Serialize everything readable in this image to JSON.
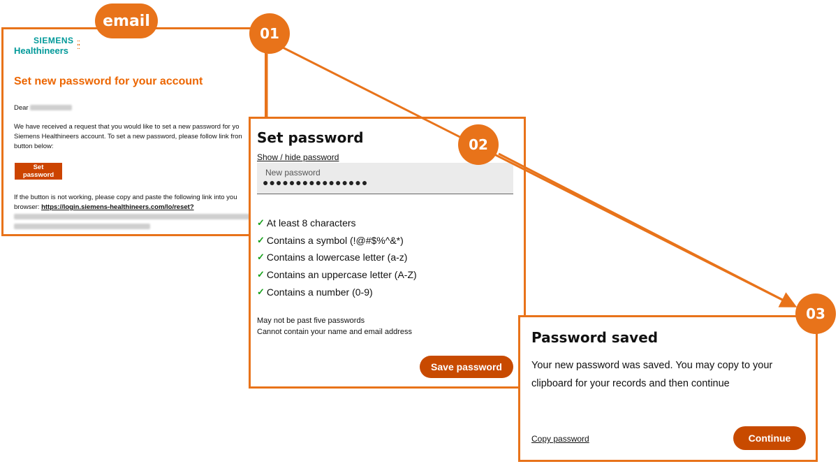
{
  "labels": {
    "email_tag": "email",
    "step1": "01",
    "step2": "02",
    "step3": "03"
  },
  "email": {
    "logo_top": "SIEMENS",
    "logo_bottom": "Healthineers",
    "title": "Set new password for your account",
    "greeting": "Dear",
    "body_line1": "We have received a request that you would like to set a new password for yo",
    "body_line2": "Siemens Healthineers account. To set a new password, please follow link fron",
    "body_line3": "button below:",
    "button": "Set password",
    "link_intro1": "If the button is not working, please copy and paste the following link into you",
    "link_intro2": "browser:",
    "link_url": "https://login.siemens-healthineers.com/lo/reset?"
  },
  "set_password": {
    "title": "Set password",
    "toggle": "Show / hide password",
    "field_label": "New password",
    "field_value": "●●●●●●●●●●●●●●●●",
    "rules": [
      "At least 8 characters",
      "Contains a symbol (!@#$%^&*)",
      "Contains a lowercase letter (a-z)",
      "Contains an uppercase letter (A-Z)",
      "Contains a number (0-9)"
    ],
    "check_mark": "✓",
    "note1": "May not be past five passwords",
    "note2": "Cannot contain your name and email address",
    "button": "Save password"
  },
  "saved": {
    "title": "Password saved",
    "message1": "Your new password was saved. You may copy to your",
    "message2": "clipboard for your records and then continue",
    "copy": "Copy password",
    "button": "Continue"
  },
  "colors": {
    "accent": "#e8731a",
    "brand_teal": "#009999",
    "button": "#c84a00",
    "check": "#15a01a"
  }
}
